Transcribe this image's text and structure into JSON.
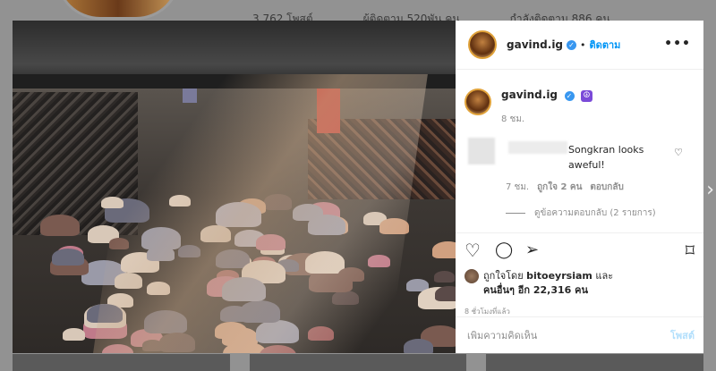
{
  "background": {
    "stats": [
      "3,762 โพสต์",
      "ผู้ติดตาม 520พัน คน",
      "กำลังติดตาม 886 คน"
    ],
    "next_arrow": "›"
  },
  "header": {
    "username": "gavind.ig",
    "verified_glyph": "✓",
    "separator": "•",
    "follow_label": "ติดตาม",
    "more_glyph": "•••"
  },
  "caption": {
    "username": "gavind.ig",
    "emoji": "☮",
    "time": "8 ชม."
  },
  "comment": {
    "text": "Songkran looks aweful!",
    "time": "7 ชม.",
    "likes": "ถูกใจ 2 คน",
    "reply_label": "ตอบกลับ",
    "view_replies": "ดูข้อความตอบกลับ (2 รายการ)"
  },
  "actions": {
    "like_icon": "♡",
    "comment_icon": "◯",
    "share_icon": "➢",
    "save_icon": "⌑"
  },
  "likes": {
    "prefix": "ถูกใจโดย",
    "user": "bitoeyrsiam",
    "and": "และ",
    "others": "คนอื่นๆ อีก 22,316 คน"
  },
  "post_time": "8 ชั่วโมงที่แล้ว",
  "add_comment": {
    "placeholder": "เพิ่มความคิดเห็น",
    "post_label": "โพสต์"
  }
}
